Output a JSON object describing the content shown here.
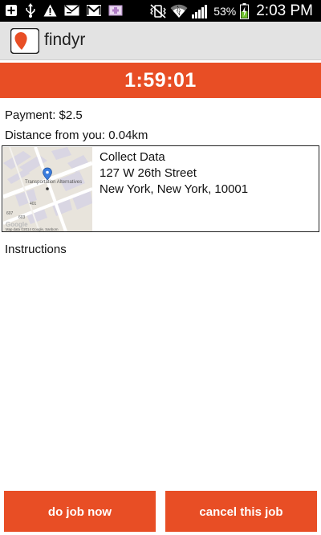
{
  "status_bar": {
    "icons_left": [
      "add-icon",
      "usb-icon",
      "warning-icon",
      "mail-icon",
      "gmail-icon",
      "image-icon"
    ],
    "icons_right": [
      "mute-vibrate-icon",
      "wifi-icon",
      "signal-icon",
      "battery-charging-icon"
    ],
    "battery": "53%",
    "battery_level": 0.53,
    "time": "2:03 PM"
  },
  "app_bar": {
    "title": "findyr",
    "logo_color": "#e84e25"
  },
  "timer": {
    "value": "1:59:01",
    "color": "#e84e25"
  },
  "job": {
    "payment": "Payment: $2.5",
    "distance": "Distance from you: 0.04km",
    "task": "Collect Data",
    "street": "127 W 26th Street",
    "city": "New York, New York, 10001",
    "map": {
      "place_label": "Transportation Alternatives",
      "numbers": [
        "401",
        "607",
        "603"
      ],
      "attribution": "Map data ©2014 Google, Sanborn",
      "watermark": "Google"
    },
    "instructions_label": "Instructions"
  },
  "buttons": {
    "do_job": "do job now",
    "cancel_job": "cancel this job"
  }
}
